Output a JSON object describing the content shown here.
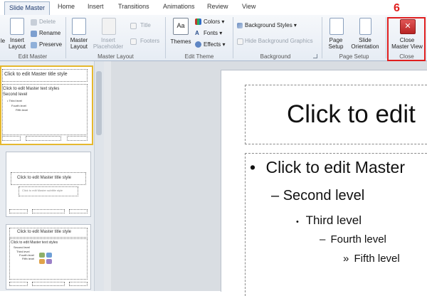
{
  "tabs": [
    "Slide Master",
    "Home",
    "Insert",
    "Transitions",
    "Animations",
    "Review",
    "View"
  ],
  "step_number": "6",
  "highlight_color": "#e01f1f",
  "ribbon": {
    "edit_master": {
      "label": "Edit Master",
      "insert_slide_master_partial": "le",
      "insert_layout": [
        "Insert",
        "Layout"
      ],
      "delete": "Delete",
      "rename": "Rename",
      "preserve": "Preserve"
    },
    "master_layout": {
      "label": "Master Layout",
      "master_layout_btn": [
        "Master",
        "Layout"
      ],
      "insert_placeholder": [
        "Insert",
        "Placeholder"
      ],
      "title": "Title",
      "footers": "Footers"
    },
    "edit_theme": {
      "label": "Edit Theme",
      "themes": "Themes",
      "colors": "Colors",
      "fonts": "Fonts",
      "effects": "Effects"
    },
    "background": {
      "label": "Background",
      "background_styles": "Background Styles",
      "hide_background_graphics": "Hide Background Graphics"
    },
    "page_setup": {
      "label": "Page Setup",
      "page_setup_btn": [
        "Page",
        "Setup"
      ],
      "slide_orientation": [
        "Slide",
        "Orientation"
      ]
    },
    "close": {
      "label": "Close",
      "close_master_view": [
        "Close",
        "Master View"
      ]
    }
  },
  "thumbnails": [
    {
      "title": "Click to edit Master title style",
      "body": [
        "Click to edit Master text styles",
        "Second level",
        "Third level",
        "Fourth level",
        "Fifth level"
      ]
    },
    {
      "title": "Click to edit Master title style",
      "subtitle": "Click to edit Master subtitle style"
    },
    {
      "title": "Click to edit Master title style",
      "body": [
        "Click to edit Master text styles",
        "Second level",
        "Third level",
        "Fourth level",
        "Fifth level"
      ]
    }
  ],
  "main_slide": {
    "title": "Click to edit",
    "bullets": [
      {
        "marker": "•",
        "text": "Click to edit Master"
      },
      {
        "marker": "–",
        "text": "Second level"
      },
      {
        "marker": "•",
        "text": "Third level"
      },
      {
        "marker": "–",
        "text": "Fourth level"
      },
      {
        "marker": "»",
        "text": "Fifth level"
      }
    ]
  }
}
